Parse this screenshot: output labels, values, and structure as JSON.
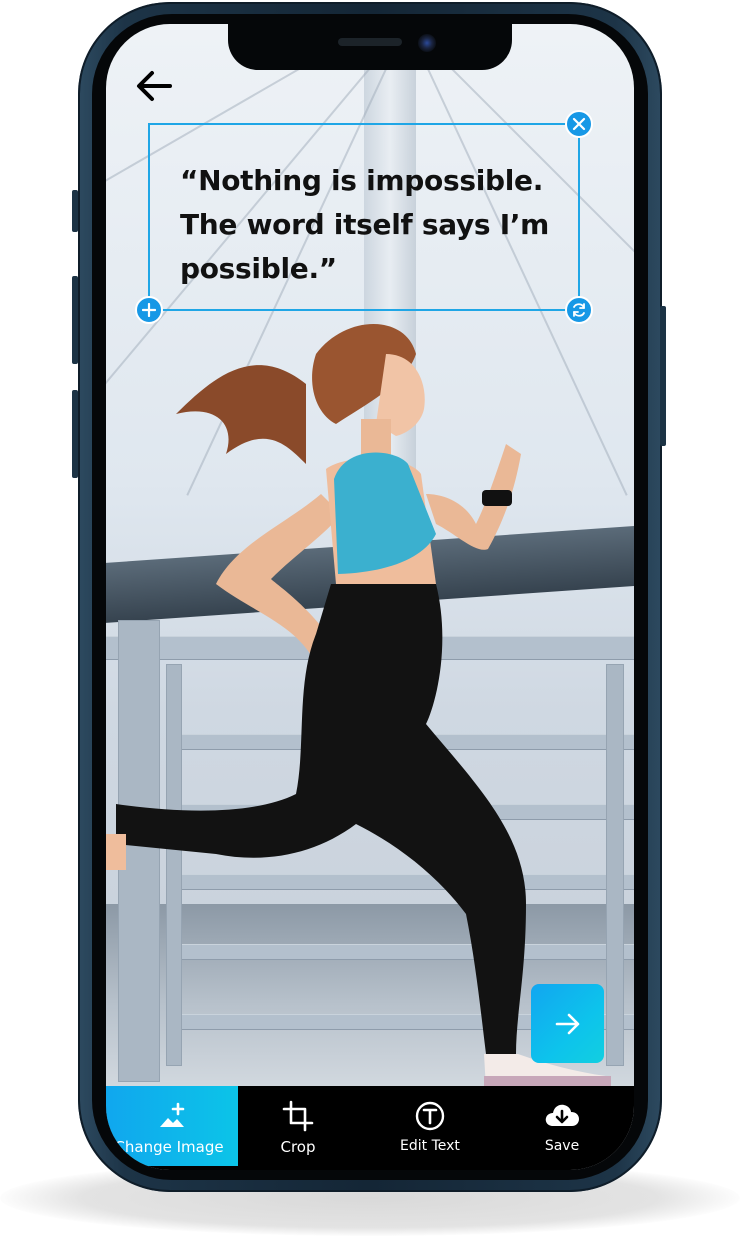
{
  "editor": {
    "quote_text": "“Nothing is impossible. The word itself says I’m possible.”"
  },
  "toolbar": {
    "items": [
      {
        "label": "Change Image",
        "icon": "add-image-icon",
        "active": true
      },
      {
        "label": "Crop",
        "icon": "crop-icon",
        "active": false
      },
      {
        "label": "Edit Text",
        "icon": "text-icon",
        "active": false
      },
      {
        "label": "Save",
        "icon": "cloud-download-icon",
        "active": false
      }
    ]
  },
  "icons": {
    "back": "arrow-left-icon",
    "next": "arrow-right-icon",
    "close_handle": "close-icon",
    "add_handle": "plus-icon",
    "rotate_handle": "rotate-icon"
  },
  "colors": {
    "accent": "#1798e6",
    "accent_gradient_end": "#0cc4e8",
    "toolbar_bg": "#000000",
    "phone_frame": "#1d3447"
  }
}
